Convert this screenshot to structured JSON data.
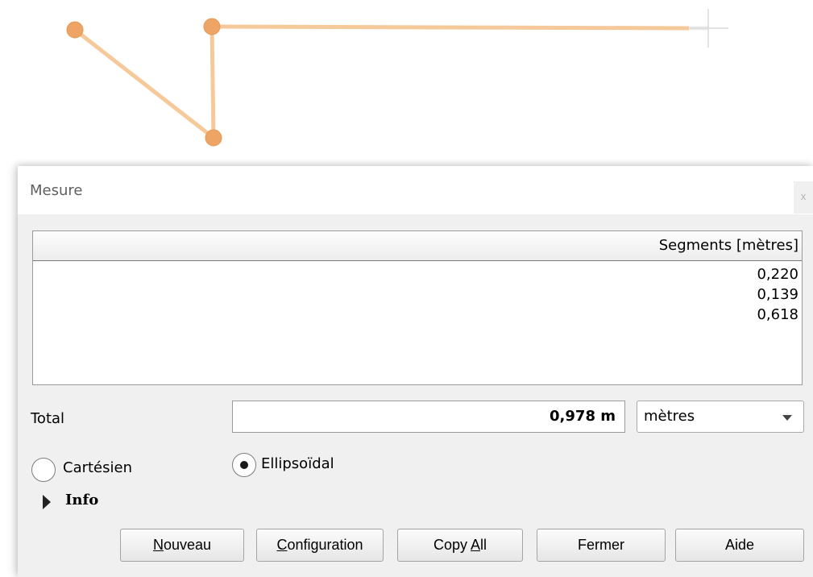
{
  "dialog": {
    "title": "Mesure",
    "close_label": "x"
  },
  "segments": {
    "header": "Segments [mètres]",
    "rows": [
      "0,220",
      "0,139",
      "0,618"
    ]
  },
  "total": {
    "label": "Total",
    "value": "0,978 m"
  },
  "units": {
    "selected": "mètres"
  },
  "mode": {
    "cartesian_label": "Cartésien",
    "ellipsoidal_label": "Ellipsoïdal",
    "selected": "Ellipsoïdal"
  },
  "info": {
    "label": "Info",
    "expanded": false
  },
  "buttons": [
    {
      "mnemonic": "N",
      "rest": "ouveau"
    },
    {
      "mnemonic": "C",
      "rest": "onfiguration"
    },
    {
      "before": "Copy ",
      "mnemonic": "A",
      "rest": "ll"
    },
    {
      "label": "Fermer"
    },
    {
      "label": "Aide"
    }
  ],
  "colors": {
    "measure_line": "#f5c999",
    "vertex": "#eea464",
    "vertex_stroke": "#e39a58",
    "dialog_bg": "#f0f0f0"
  }
}
